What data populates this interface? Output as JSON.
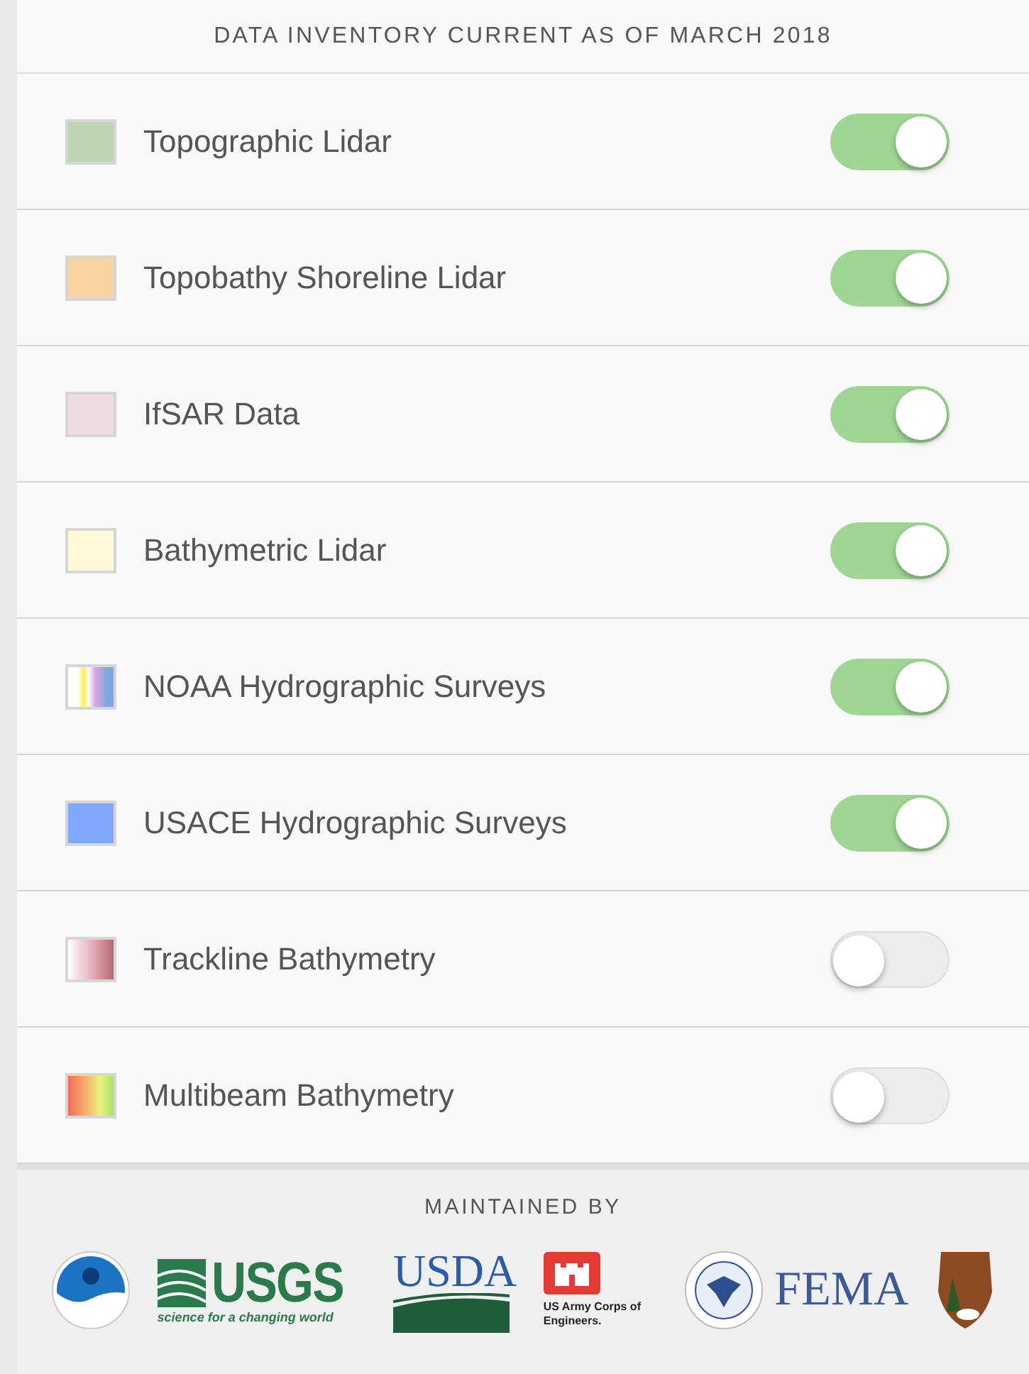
{
  "header": "DATA INVENTORY CURRENT AS OF MARCH 2018",
  "layers": [
    {
      "label": "Topographic Lidar",
      "kind": "solid",
      "color": "#bcd4b0",
      "on": true
    },
    {
      "label": "Topobathy Shoreline Lidar",
      "kind": "solid",
      "color": "#f7d4a2",
      "on": true
    },
    {
      "label": "IfSAR Data",
      "kind": "solid",
      "color": "#f1dbe3",
      "on": true
    },
    {
      "label": "Bathymetric Lidar",
      "kind": "solid",
      "color": "#fdf9d8",
      "on": true
    },
    {
      "label": "NOAA Hydrographic Surveys",
      "kind": "stripes",
      "on": true
    },
    {
      "label": "USACE Hydrographic Surveys",
      "kind": "solid",
      "color": "#7ea6f9",
      "on": true
    },
    {
      "label": "Trackline Bathymetry",
      "kind": "fade",
      "on": false
    },
    {
      "label": "Multibeam Bathymetry",
      "kind": "rainbow",
      "on": false
    }
  ],
  "footer": {
    "title": "MAINTAINED BY",
    "logos": [
      {
        "kind": "noaa"
      },
      {
        "kind": "usgs",
        "text": "USGS",
        "tagline": "science for a changing world"
      },
      {
        "kind": "usda",
        "text": "USDA"
      },
      {
        "kind": "usace",
        "text": "US Army Corps of Engineers."
      },
      {
        "kind": "fema",
        "text": "FEMA"
      },
      {
        "kind": "nps"
      }
    ]
  }
}
